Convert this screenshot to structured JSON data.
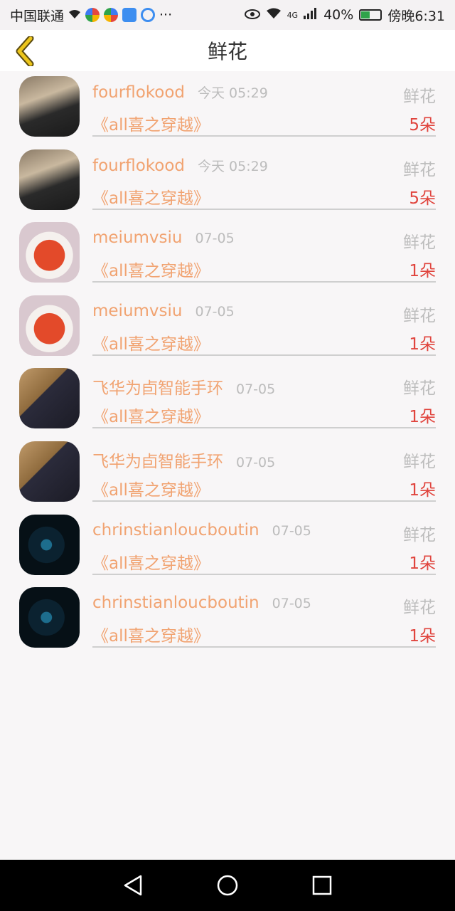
{
  "status_bar": {
    "carrier": "中国联通",
    "more": "···",
    "battery": "40%",
    "network": "4G",
    "time": "傍晚6:31"
  },
  "header": {
    "title": "鲜花",
    "back_icon": "chevron-left-icon",
    "accent_color": "#e8c11a"
  },
  "colors": {
    "username": "#f1a371",
    "time": "#bcbcbc",
    "count": "#e0443d",
    "divider": "#cfcfcf"
  },
  "items": [
    {
      "user": "fourflokood",
      "time": "今天 05:29",
      "type": "鲜花",
      "book": "《all喜之穿越》",
      "count": "5朵",
      "avatar": "person"
    },
    {
      "user": "fourflokood",
      "time": "今天 05:29",
      "type": "鲜花",
      "book": "《all喜之穿越》",
      "count": "5朵",
      "avatar": "person"
    },
    {
      "user": "meiumvsiu",
      "time": "07-05",
      "type": "鲜花",
      "book": "《all喜之穿越》",
      "count": "1朵",
      "avatar": "soup"
    },
    {
      "user": "meiumvsiu",
      "time": "07-05",
      "type": "鲜花",
      "book": "《all喜之穿越》",
      "count": "1朵",
      "avatar": "soup"
    },
    {
      "user": "飞华为卣智能手环",
      "time": "07-05",
      "type": "鲜花",
      "book": "《all喜之穿越》",
      "count": "1朵",
      "avatar": "anime"
    },
    {
      "user": "飞华为卣智能手环",
      "time": "07-05",
      "type": "鲜花",
      "book": "《all喜之穿越》",
      "count": "1朵",
      "avatar": "anime"
    },
    {
      "user": "chrinstianloucboutin",
      "time": "07-05",
      "type": "鲜花",
      "book": "《all喜之穿越》",
      "count": "1朵",
      "avatar": "circuit"
    },
    {
      "user": "chrinstianloucboutin",
      "time": "07-05",
      "type": "鲜花",
      "book": "《all喜之穿越》",
      "count": "1朵",
      "avatar": "circuit"
    }
  ],
  "nav": {
    "back_icon": "triangle-back-icon",
    "home_icon": "circle-home-icon",
    "recent_icon": "square-recent-icon"
  }
}
